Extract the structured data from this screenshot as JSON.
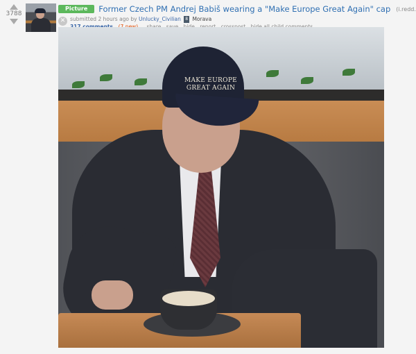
{
  "post": {
    "score": "3788",
    "flair": "Picture",
    "title": "Former Czech PM Andrej Babiš wearing a \"Make Europe Great Again\" cap",
    "domain": "(i.redd.it)",
    "submitted_prefix": "submitted 2 hours ago by",
    "author": "Unlucky_Civilian",
    "author_flag": "8",
    "author_flair": "Morava",
    "comments_label": "317 comments",
    "new_comments": "(7 new)",
    "actions": [
      "share",
      "save",
      "hide",
      "report",
      "crosspost",
      "hide all child comments"
    ]
  },
  "image": {
    "cap_text_line1": "MAKE EUROPE",
    "cap_text_line2": "GREAT AGAIN"
  },
  "colors": {
    "flair_bg": "#5cb85c",
    "title_link": "#2f6fb2",
    "new_comments": "#e04a00"
  },
  "icons": [
    "upvote-arrow-icon",
    "downvote-arrow-icon",
    "close-icon"
  ]
}
